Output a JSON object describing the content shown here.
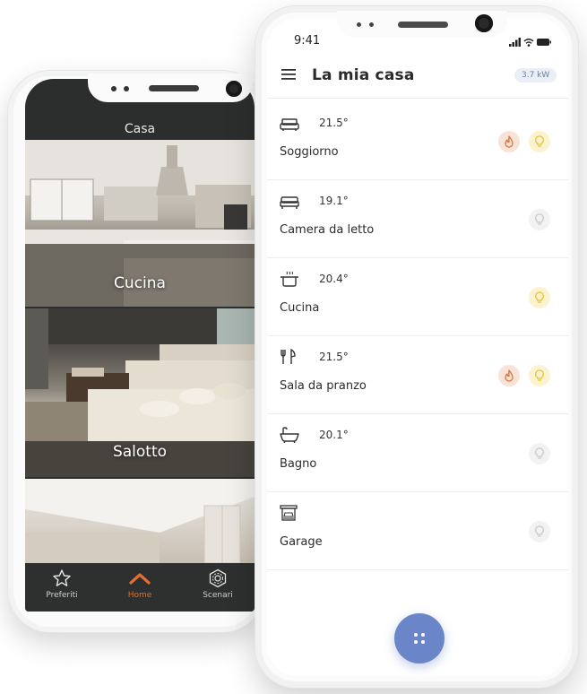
{
  "back_phone": {
    "title": "Casa",
    "rooms": [
      {
        "label": "Cucina"
      },
      {
        "label": "Salotto"
      }
    ],
    "tabs": [
      {
        "label": "Preferiti",
        "icon": "star-icon"
      },
      {
        "label": "Home",
        "icon": "home-icon"
      },
      {
        "label": "Scenari",
        "icon": "scenes-icon"
      }
    ]
  },
  "front_phone": {
    "status_time": "9:41",
    "title": "La mia casa",
    "power": "3.7 kW",
    "rooms": [
      {
        "name": "Soggiorno",
        "temp": "21.5°",
        "icon": "sofa-icon",
        "heating": true,
        "light": "on"
      },
      {
        "name": "Camera da letto",
        "temp": "19.1°",
        "icon": "bed-icon",
        "heating": false,
        "light": "off"
      },
      {
        "name": "Cucina",
        "temp": "20.4°",
        "icon": "pot-icon",
        "heating": false,
        "light": "on"
      },
      {
        "name": "Sala da pranzo",
        "temp": "21.5°",
        "icon": "cutlery-icon",
        "heating": true,
        "light": "on"
      },
      {
        "name": "Bagno",
        "temp": "20.1°",
        "icon": "bathtub-icon",
        "heating": false,
        "light": "off"
      },
      {
        "name": "Garage",
        "temp": "",
        "icon": "garage-icon",
        "heating": false,
        "light": "off"
      }
    ]
  },
  "colors": {
    "accent": "#e07030",
    "fab": "#6a86c8",
    "flame_chip": "#f9e2d6",
    "bulb_on_chip": "#fbf3cf"
  }
}
